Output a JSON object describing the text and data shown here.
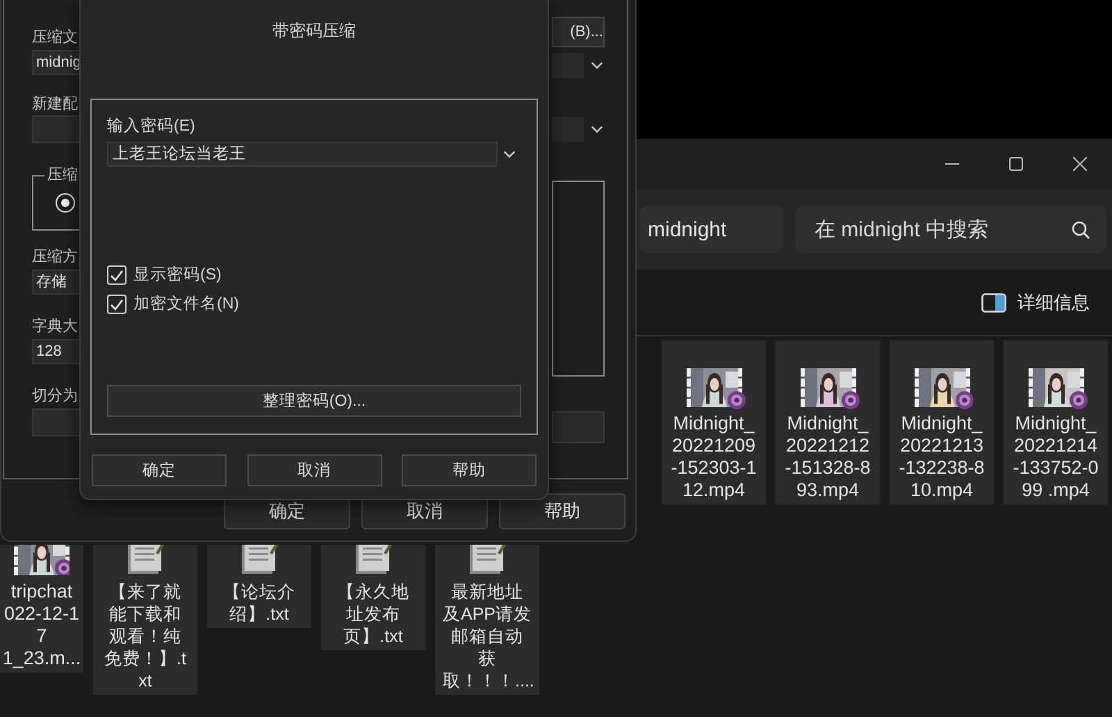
{
  "explorer": {
    "address": "midnight",
    "search": {
      "placeholder": "在 midnight 中搜索"
    },
    "details_button": "详细信息",
    "file_rows": [
      {
        "files": [
          {
            "kind": "video",
            "name": "Midnight_\n20221209\n-152303-1\n12.mp4",
            "selected": true
          },
          {
            "kind": "video",
            "name": "Midnight_\n20221212\n-151328-8\n93.mp4",
            "selected": true
          },
          {
            "kind": "video",
            "name": "Midnight_\n20221213\n-132238-8\n10.mp4",
            "selected": true
          },
          {
            "kind": "video",
            "name": "Midnight_\n20221214\n-133752-0\n99 .mp4",
            "selected": true
          }
        ]
      },
      {
        "files": [
          {
            "kind": "video",
            "name": "tripchat\n022-12-1\n7\n1_23.m...",
            "selected": true
          },
          {
            "kind": "text",
            "name": "【来了就能下载和观看！纯免费！】.txt",
            "selected": true
          },
          {
            "kind": "text",
            "name": "【论坛介绍】.txt",
            "selected": true
          },
          {
            "kind": "text",
            "name": "【永久地址发布页】.txt",
            "selected": true
          },
          {
            "kind": "text",
            "name": "最新地址及APP请发邮箱自动获取！！！....",
            "selected": true
          }
        ]
      }
    ]
  },
  "archive_window": {
    "left_items": [
      {
        "kind": "field",
        "label": "压缩文",
        "value": "midnig"
      },
      {
        "kind": "field",
        "label": "新建配"
      },
      {
        "kind": "group",
        "label": "压缩",
        "radio_selected": true
      },
      {
        "kind": "field",
        "label": "压缩方",
        "value": "存储"
      },
      {
        "kind": "field",
        "label": "字典大",
        "value": "128"
      },
      {
        "kind": "field",
        "label": "切分为"
      }
    ],
    "browse_button": "(B)...",
    "buttons": [
      "确定",
      "取消",
      "帮助"
    ]
  },
  "password_dialog": {
    "title": "带密码压缩",
    "password_label": "输入密码(E)",
    "password": "上老王论坛当老王",
    "options": [
      {
        "label": "显示密码(S)",
        "checked": true
      },
      {
        "label": "加密文件名(N)",
        "checked": true
      }
    ],
    "organize_button": "整理密码(O)...",
    "buttons": [
      "确定",
      "取消",
      "帮助"
    ]
  }
}
